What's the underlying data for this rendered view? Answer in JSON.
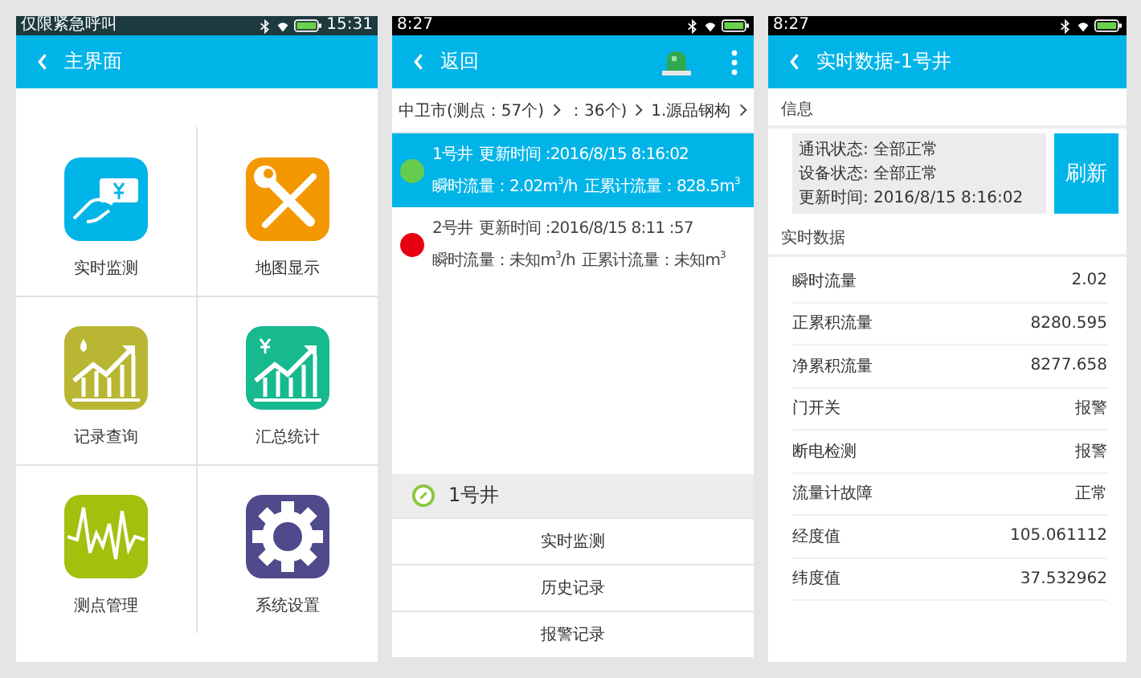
{
  "home": {
    "status_bar": {
      "carrier": "仅限紧急呼叫",
      "time": "15:31"
    },
    "header": {
      "title": "主界面"
    },
    "tiles": [
      {
        "label": "实时监测",
        "kind": "card",
        "color": "#00b4e8"
      },
      {
        "label": "地图显示",
        "kind": "tools",
        "color": "#f39800"
      },
      {
        "label": "记录查询",
        "kind": "drop_chart",
        "color": "#b8b632"
      },
      {
        "label": "汇总统计",
        "kind": "yen_chart",
        "color": "#17b98f"
      },
      {
        "label": "测点管理",
        "kind": "wave",
        "color": "#a3c00f"
      },
      {
        "label": "系统设置",
        "kind": "gear",
        "color": "#4f4a8c"
      }
    ]
  },
  "well_list": {
    "status_bar": {
      "time": "8:27"
    },
    "header": {
      "back": "返回"
    },
    "breadcrumb": [
      "中卫市(测点：57个)",
      "：36个)",
      "1.源品钢构"
    ],
    "wells": [
      {
        "name": "1号井",
        "time": "更新时间 :2016/8/15 8:16:02",
        "flow": "瞬时流量：2.02m$^{3}$/h",
        "total": "正累计流量：828.5m$^{3}$",
        "color": "#66cc4e",
        "selected": true
      },
      {
        "name": "2号井",
        "time": "更新时间 :2016/8/15 8:11 :57",
        "flow": "瞬时流量：未知m$^{3}$/h",
        "total": "正累计流量：未知m$^{3}$",
        "color": "#e60012",
        "selected": false
      }
    ],
    "popup": {
      "title": "1号井",
      "actions": [
        "实时监测",
        "历史记录",
        "报警记录"
      ]
    }
  },
  "realtime": {
    "status_bar": {
      "time": "8:27"
    },
    "header": {
      "title": "实时数据-1号井"
    },
    "info_label": "信息",
    "info_lines": [
      "通讯状态: 全部正常",
      "设备状态: 全部正常",
      "更新时间: 2016/8/15 8:16:02"
    ],
    "refresh": "刷新",
    "data_label": "实时数据",
    "rows": [
      {
        "name": "瞬时流量",
        "value": "2.02"
      },
      {
        "name": "正累积流量",
        "value": "8280.595"
      },
      {
        "name": "净累积流量",
        "value": "8277.658"
      },
      {
        "name": "门开关",
        "value": "报警"
      },
      {
        "name": "断电检测",
        "value": "报警"
      },
      {
        "name": "流量计故障",
        "value": "正常"
      },
      {
        "name": "经度值",
        "value": "105.061112"
      },
      {
        "name": "纬度值",
        "value": "37.532962"
      }
    ]
  }
}
